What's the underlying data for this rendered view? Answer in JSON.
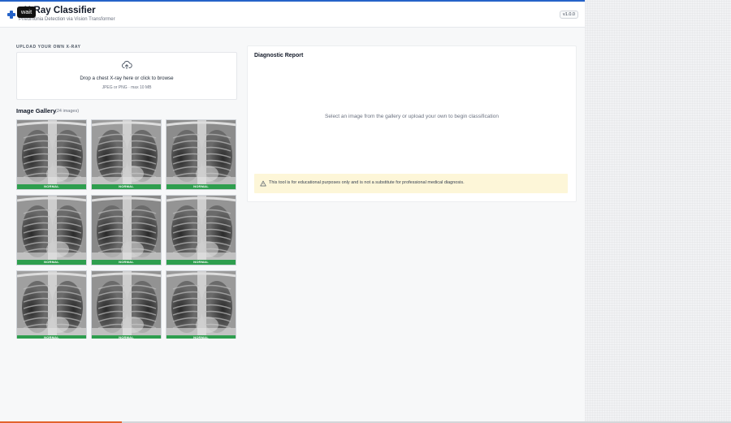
{
  "header": {
    "title": "t X-Ray Classifier",
    "subtitle": "Pneumonia Detection via Vision Transformer",
    "version": "v1.0.0",
    "tooltip": "wait"
  },
  "upload": {
    "section_label": "UPLOAD YOUR OWN X-RAY",
    "drop_text": "Drop a chest X-ray here or click to browse",
    "drop_sub": "JPEG or PNG · max 10 MB"
  },
  "gallery": {
    "title": "Image Gallery",
    "count": "(24 images)",
    "items": [
      {
        "label": "NORMAL"
      },
      {
        "label": "NORMAL"
      },
      {
        "label": "NORMAL"
      },
      {
        "label": "NORMAL"
      },
      {
        "label": "NORMAL"
      },
      {
        "label": "NORMAL"
      },
      {
        "label": "NORMAL"
      },
      {
        "label": "NORMAL"
      },
      {
        "label": "NORMAL"
      }
    ]
  },
  "report": {
    "title": "Diagnostic Report",
    "empty_text": "Select an image from the gallery or upload your own to begin classification",
    "disclaimer": "This tool is for educational purposes only and is not a substitute for professional medical diagnosis."
  },
  "loading": {
    "progress": 0.167
  },
  "colors": {
    "accent": "#2563c9",
    "normal_tag": "#2e9e4e",
    "progress": "#e2632d",
    "disclaimer_bg": "#fdf6d8"
  },
  "icons": {
    "logo": "plus-cross-icon",
    "upload": "cloud-upload-icon",
    "warning": "warning-triangle-icon"
  }
}
